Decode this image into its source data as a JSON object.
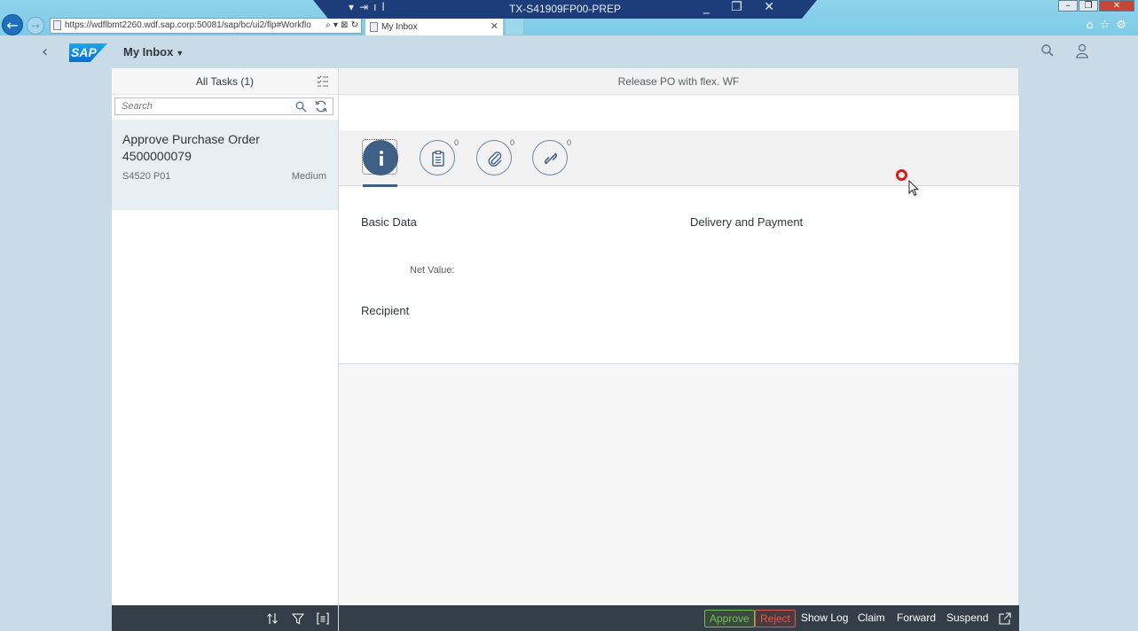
{
  "browser": {
    "url": "https://wdflbmt2260.wdf.sap.corp:50081/sap/bc/ui2/flp#Workflo",
    "tab_label": "My Inbox",
    "remote_session_title": "TX-S41909FP00-PREP"
  },
  "shell": {
    "logo_text": "SAP",
    "app_title": "My Inbox"
  },
  "master": {
    "title": "All Tasks (1)",
    "search_placeholder": "Search",
    "items": [
      {
        "title": "Approve Purchase Order 4500000079",
        "system": "S4520 P01",
        "priority": "Medium"
      }
    ]
  },
  "detail": {
    "title": "Release PO with flex. WF",
    "tabs": [
      {
        "icon": "info-icon",
        "count": ""
      },
      {
        "icon": "notes-icon",
        "count": "0"
      },
      {
        "icon": "attachment-icon",
        "count": "0"
      },
      {
        "icon": "link-icon",
        "count": "0"
      }
    ],
    "sections": {
      "basic_data": "Basic Data",
      "delivery_payment": "Delivery and Payment",
      "net_value_label": "Net Value:",
      "recipient": "Recipient"
    },
    "actions": {
      "approve": "Approve",
      "reject": "Reject",
      "show_log": "Show Log",
      "claim": "Claim",
      "forward": "Forward",
      "suspend": "Suspend"
    }
  },
  "colors": {
    "accent": "#3e6085",
    "footer": "#333e48",
    "approve": "#6fc35c",
    "reject": "#e05a52"
  }
}
